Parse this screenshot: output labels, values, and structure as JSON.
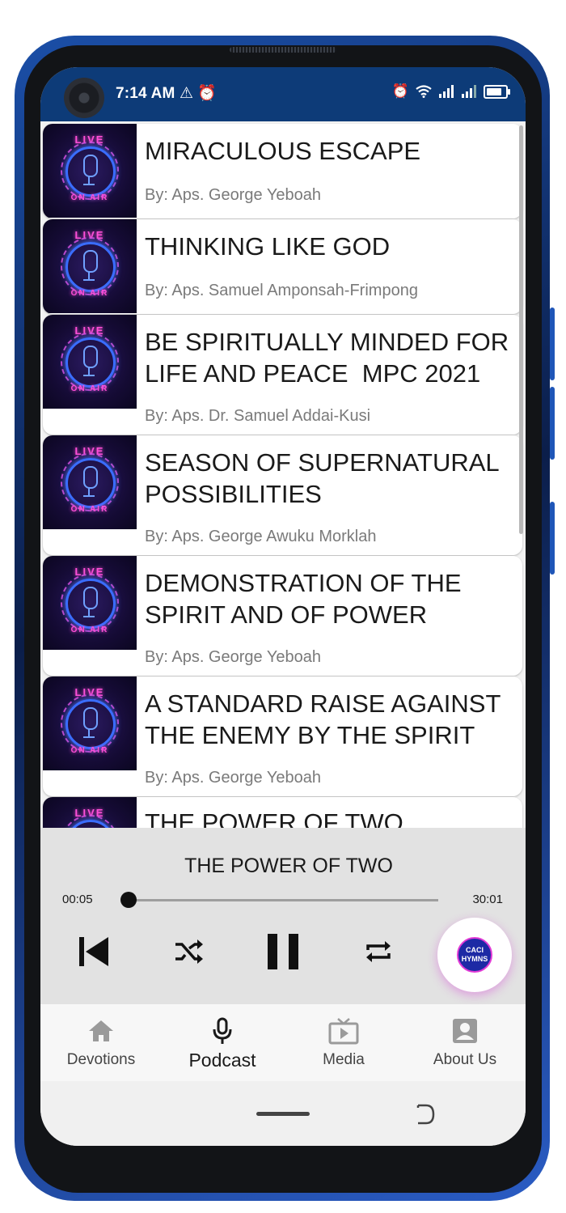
{
  "status_bar": {
    "time": "7:14 AM",
    "left_icons": [
      "warning-icon",
      "alarm-icon"
    ],
    "right_icons": [
      "alarm-icon",
      "wifi-icon",
      "signal-icon",
      "signal-icon",
      "battery-icon"
    ]
  },
  "podcasts": [
    {
      "title": "MIRACULOUS ESCAPE",
      "author": "By: Aps. George Yeboah"
    },
    {
      "title": "THINKING LIKE GOD",
      "author": "By: Aps. Samuel Amponsah-Frimpong"
    },
    {
      "title": "BE SPIRITUALLY MINDED FOR\nLIFE AND PEACE  MPC 2021",
      "author": "By: Aps. Dr. Samuel Addai-Kusi"
    },
    {
      "title": "SEASON OF SUPERNATURAL\nPOSSIBILITIES",
      "author": "By: Aps. George Awuku Morklah"
    },
    {
      "title": "DEMONSTRATION OF THE\nSPIRIT AND OF POWER",
      "author": "By: Aps. George Yeboah"
    },
    {
      "title": "A STANDARD RAISE AGAINST\nTHE ENEMY BY THE SPIRIT",
      "author": "By: Aps. George Yeboah"
    },
    {
      "title": "THE POWER OF TWO",
      "author": ""
    }
  ],
  "thumbnail_text": {
    "top": "LIVE",
    "bottom": "ON AIR"
  },
  "player": {
    "now_playing": "THE POWER OF TWO",
    "elapsed": "00:05",
    "duration": "30:01",
    "progress_fraction": 0.003,
    "controls": [
      "skip-previous-icon",
      "shuffle-icon",
      "pause-icon",
      "repeat-icon"
    ],
    "fab_logo_text": "CACI HYMNS"
  },
  "bottom_nav": {
    "items": [
      {
        "label": "Devotions",
        "icon": "home-icon"
      },
      {
        "label": "Podcast",
        "icon": "microphone-icon"
      },
      {
        "label": "Media",
        "icon": "tv-play-icon"
      },
      {
        "label": "About Us",
        "icon": "account-box-icon"
      }
    ],
    "active_index": 1
  },
  "colors": {
    "status_bar": "#0d3b78",
    "player_background": "#e2e2e2",
    "fab_glow": "#d64ad8",
    "thumbnail_neon_pink": "#ff4fd8",
    "thumbnail_neon_blue": "#3a6dff"
  }
}
